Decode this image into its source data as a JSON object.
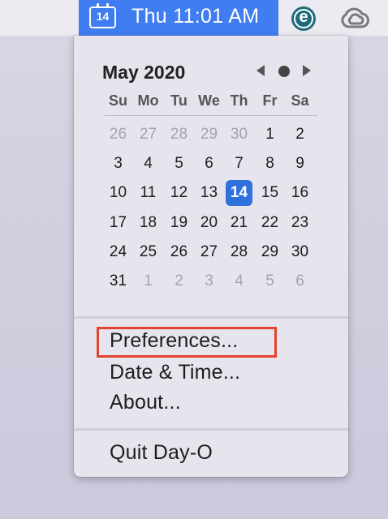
{
  "menubar": {
    "calendar_icon_day": "14",
    "clock_text": "Thu 11:01 AM",
    "eset_icon_letter": "e"
  },
  "calendar": {
    "month_title": "May 2020",
    "weekdays": [
      "Su",
      "Mo",
      "Tu",
      "We",
      "Th",
      "Fr",
      "Sa"
    ],
    "weeks": [
      [
        "26",
        "27",
        "28",
        "29",
        "30",
        "1",
        "2"
      ],
      [
        "3",
        "4",
        "5",
        "6",
        "7",
        "8",
        "9"
      ],
      [
        "10",
        "11",
        "12",
        "13",
        "14",
        "15",
        "16"
      ],
      [
        "17",
        "18",
        "19",
        "20",
        "21",
        "22",
        "23"
      ],
      [
        "24",
        "25",
        "26",
        "27",
        "28",
        "29",
        "30"
      ],
      [
        "31",
        "1",
        "2",
        "3",
        "4",
        "5",
        "6"
      ]
    ],
    "today": "14"
  },
  "menu": {
    "preferences": "Preferences...",
    "date_time": "Date & Time...",
    "about": "About...",
    "quit": "Quit Day-O"
  },
  "colors": {
    "accent": "#3f7df0",
    "today_highlight": "#2f70dd",
    "annotation_box": "#e3422f"
  }
}
